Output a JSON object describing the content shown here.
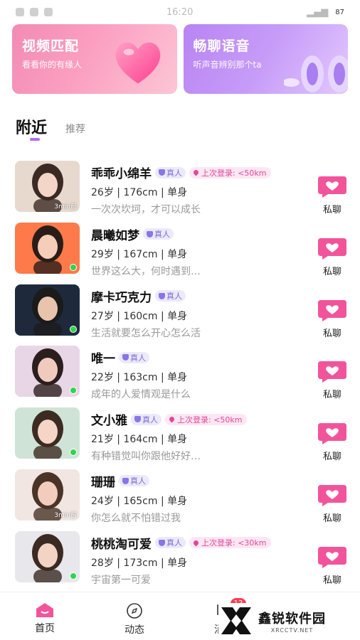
{
  "status_bar": {
    "time": "16:20",
    "battery": "87"
  },
  "banners": [
    {
      "title": "视频匹配",
      "subtitle": "看看你的有缘人",
      "color": "#f28bb5"
    },
    {
      "title": "畅聊语音",
      "subtitle": "听声音辨别那个ta",
      "color": "#b884f3"
    }
  ],
  "tabs": {
    "active": "附近",
    "inactive": "推荐"
  },
  "users": [
    {
      "name": "乖乖小绵羊",
      "real": "真人",
      "login": "上次登录: <50km",
      "info": "26岁 | 176cm | 单身",
      "sign": "一次次坎坷，才可以成长",
      "last_active": "3min前",
      "online": false,
      "chat": "私聊"
    },
    {
      "name": "晨曦如梦",
      "real": "真人",
      "login": "",
      "info": "29岁 | 167cm | 单身",
      "sign": "世界这么大，何时遇到…",
      "last_active": "",
      "online": true,
      "chat": "私聊"
    },
    {
      "name": "摩卡巧克力",
      "real": "真人",
      "login": "",
      "info": "27岁 | 160cm | 单身",
      "sign": "生活就要怎么开心怎么活",
      "last_active": "",
      "online": true,
      "chat": "私聊"
    },
    {
      "name": "唯一",
      "real": "真人",
      "login": "",
      "info": "22岁 | 163cm | 单身",
      "sign": "成年的人爱情观是什么",
      "last_active": "",
      "online": true,
      "chat": "私聊"
    },
    {
      "name": "文小雅",
      "real": "真人",
      "login": "上次登录: <50km",
      "info": "21岁 | 164cm | 单身",
      "sign": "有种错觉叫你跟他好好…",
      "last_active": "",
      "online": true,
      "chat": "私聊"
    },
    {
      "name": "珊珊",
      "real": "真人",
      "login": "",
      "info": "24岁 | 165cm | 单身",
      "sign": "你怎么就不怕错过我",
      "last_active": "3min前",
      "online": false,
      "chat": "私聊"
    },
    {
      "name": "桃桃淘可爱",
      "real": "真人",
      "login": "上次登录: <30km",
      "info": "28岁 | 173cm | 单身",
      "sign": "宇宙第一可爱",
      "last_active": "",
      "online": true,
      "chat": "私聊"
    }
  ],
  "bottom_nav": [
    {
      "label": "首页",
      "icon": "home-icon"
    },
    {
      "label": "动态",
      "icon": "compass-icon"
    },
    {
      "label": "消息",
      "icon": "message-icon",
      "badge": "12"
    }
  ],
  "watermark": {
    "cn": "鑫锐软件园",
    "en": "XRCCTV.NET"
  },
  "colors": {
    "accent_purple": "#b46cf5",
    "chat_pink": "#f2549b",
    "online_green": "#2fd34f",
    "login_pink": "#e0489a",
    "real_purple": "#7c6ad6"
  }
}
